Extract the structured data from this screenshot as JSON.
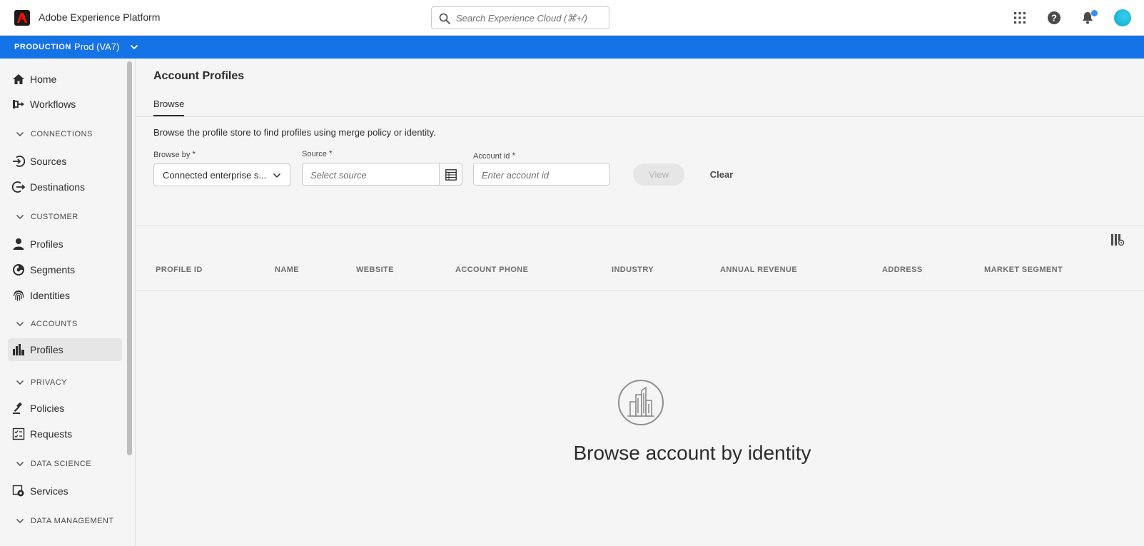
{
  "header": {
    "app_title": "Adobe Experience Platform",
    "search_placeholder": "Search Experience Cloud (⌘+/)",
    "icons": [
      "apps-grid-icon",
      "help-icon",
      "bell-icon",
      "avatar"
    ]
  },
  "environment": {
    "label": "PRODUCTION",
    "sandbox": "Prod (VA7)"
  },
  "sidebar": {
    "top_items": [
      {
        "label": "Home",
        "icon": "home-icon"
      },
      {
        "label": "Workflows",
        "icon": "workflows-icon"
      }
    ],
    "sections": [
      {
        "title": "CONNECTIONS",
        "items": [
          {
            "label": "Sources",
            "icon": "sources-icon"
          },
          {
            "label": "Destinations",
            "icon": "destinations-icon"
          }
        ]
      },
      {
        "title": "CUSTOMER",
        "items": [
          {
            "label": "Profiles",
            "icon": "person-icon"
          },
          {
            "label": "Segments",
            "icon": "segments-icon"
          },
          {
            "label": "Identities",
            "icon": "fingerprint-icon"
          }
        ]
      },
      {
        "title": "ACCOUNTS",
        "items": [
          {
            "label": "Profiles",
            "icon": "building-icon",
            "active": true
          }
        ]
      },
      {
        "title": "PRIVACY",
        "items": [
          {
            "label": "Policies",
            "icon": "gavel-icon"
          },
          {
            "label": "Requests",
            "icon": "checklist-icon"
          }
        ]
      },
      {
        "title": "DATA SCIENCE",
        "items": [
          {
            "label": "Services",
            "icon": "services-gear-icon"
          }
        ]
      },
      {
        "title": "DATA MANAGEMENT",
        "items": []
      }
    ]
  },
  "main": {
    "title": "Account Profiles",
    "tab": "Browse",
    "description": "Browse the profile store to find profiles using merge policy or identity.",
    "form": {
      "browse_by_label": "Browse by",
      "browse_by_value": "Connected enterprise s...",
      "source_label": "Source",
      "source_placeholder": "Select source",
      "account_label": "Account id",
      "account_placeholder": "Enter account id",
      "required_marker": "*",
      "view_label": "View",
      "clear_label": "Clear"
    },
    "table": {
      "columns": [
        "PROFILE ID",
        "NAME",
        "WEBSITE",
        "ACCOUNT PHONE",
        "INDUSTRY",
        "ANNUAL REVENUE",
        "ADDRESS",
        "MARKET SEGMENT"
      ]
    },
    "empty_state": "Browse account by identity"
  },
  "colors": {
    "env_bar": "#1473e6",
    "notification_dot": "#378ef0"
  }
}
